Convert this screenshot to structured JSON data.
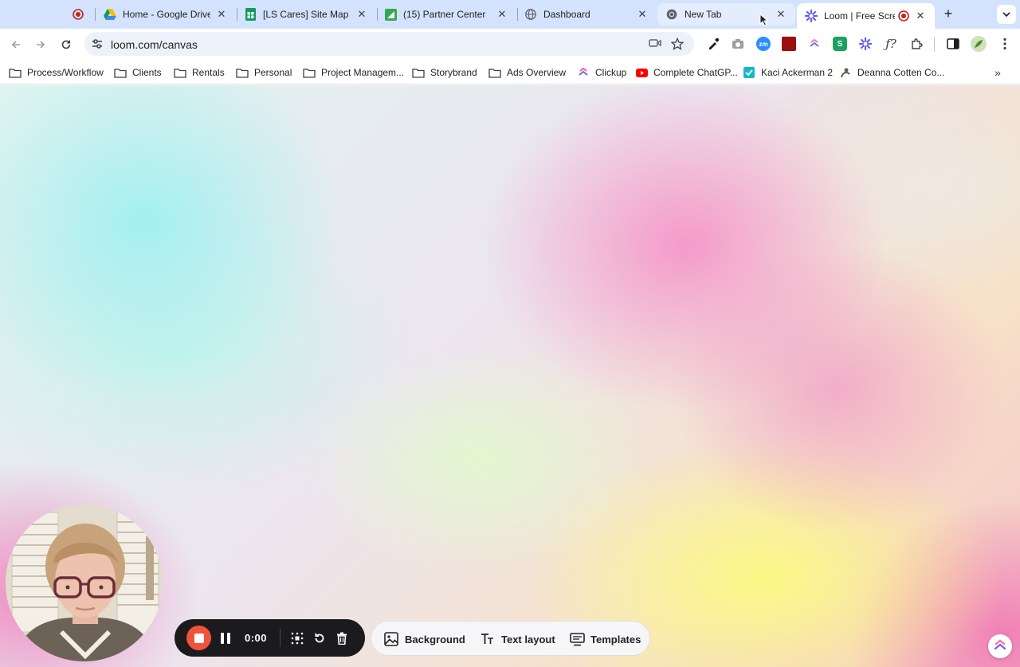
{
  "browser": {
    "tabs": [
      {
        "title": "",
        "favicon": "recording-dot-icon"
      },
      {
        "title": "Home - Google Drive",
        "favicon": "google-drive-icon"
      },
      {
        "title": "[LS Cares] Site Map - G",
        "favicon": "google-sheets-icon"
      },
      {
        "title": "(15) Partner Center",
        "favicon": "partner-center-icon"
      },
      {
        "title": "Dashboard",
        "favicon": "globe-icon"
      },
      {
        "title": "New Tab",
        "favicon": "chrome-icon"
      },
      {
        "title": "Loom | Free Screen",
        "favicon": "loom-icon"
      }
    ],
    "address": {
      "url": "loom.com/canvas"
    },
    "bookmarks": [
      {
        "label": "Process/Workflow",
        "icon": "folder-icon"
      },
      {
        "label": "Clients",
        "icon": "folder-icon"
      },
      {
        "label": "Rentals",
        "icon": "folder-icon"
      },
      {
        "label": "Personal",
        "icon": "folder-icon"
      },
      {
        "label": "Project Managem...",
        "icon": "folder-icon"
      },
      {
        "label": "Storybrand",
        "icon": "folder-icon"
      },
      {
        "label": "Ads Overview",
        "icon": "folder-icon"
      },
      {
        "label": "Clickup",
        "icon": "clickup-icon"
      },
      {
        "label": "Complete ChatGP...",
        "icon": "youtube-icon"
      },
      {
        "label": "Kaci Ackerman 2",
        "icon": "checkbox-app-icon"
      },
      {
        "label": "Deanna Cotten Co...",
        "icon": "person-app-icon"
      }
    ]
  },
  "loom": {
    "timer": "0:00",
    "options": {
      "background": "Background",
      "text_layout": "Text layout",
      "templates": "Templates"
    }
  },
  "colors": {
    "tab_strip": "#d3e3fd",
    "record_red": "#f0533d",
    "control_bar": "#1b1b1d"
  }
}
